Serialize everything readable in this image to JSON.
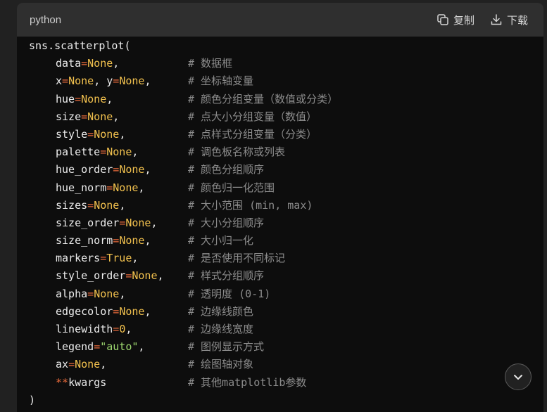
{
  "header": {
    "language": "python",
    "copy_label": "复制",
    "download_label": "下载",
    "copy_icon": "copy-icon",
    "download_icon": "download-icon"
  },
  "code": {
    "opening": "sns.scatterplot(",
    "closing": ")",
    "params": [
      {
        "name": "data",
        "op": "=",
        "value": "None",
        "value_type": "none",
        "suffix": ",",
        "comment": "# 数据框"
      },
      {
        "name": "x",
        "op": "=",
        "value": "None",
        "value_type": "none",
        "suffix": ", ",
        "name2": "y",
        "value2": "None",
        "suffix2": ",",
        "comment": "# 坐标轴变量"
      },
      {
        "name": "hue",
        "op": "=",
        "value": "None",
        "value_type": "none",
        "suffix": ",",
        "comment": "# 颜色分组变量（数值或分类）"
      },
      {
        "name": "size",
        "op": "=",
        "value": "None",
        "value_type": "none",
        "suffix": ",",
        "comment": "# 点大小分组变量（数值）"
      },
      {
        "name": "style",
        "op": "=",
        "value": "None",
        "value_type": "none",
        "suffix": ",",
        "comment": "# 点样式分组变量（分类）"
      },
      {
        "name": "palette",
        "op": "=",
        "value": "None",
        "value_type": "none",
        "suffix": ",",
        "comment": "# 调色板名称或列表"
      },
      {
        "name": "hue_order",
        "op": "=",
        "value": "None",
        "value_type": "none",
        "suffix": ",",
        "comment": "# 颜色分组顺序"
      },
      {
        "name": "hue_norm",
        "op": "=",
        "value": "None",
        "value_type": "none",
        "suffix": ",",
        "comment": "# 颜色归一化范围"
      },
      {
        "name": "sizes",
        "op": "=",
        "value": "None",
        "value_type": "none",
        "suffix": ",",
        "comment": "# 大小范围 (min, max)"
      },
      {
        "name": "size_order",
        "op": "=",
        "value": "None",
        "value_type": "none",
        "suffix": ",",
        "comment": "# 大小分组顺序"
      },
      {
        "name": "size_norm",
        "op": "=",
        "value": "None",
        "value_type": "none",
        "suffix": ",",
        "comment": "# 大小归一化"
      },
      {
        "name": "markers",
        "op": "=",
        "value": "True",
        "value_type": "none",
        "suffix": ",",
        "comment": "# 是否使用不同标记"
      },
      {
        "name": "style_order",
        "op": "=",
        "value": "None",
        "value_type": "none",
        "suffix": ",",
        "comment": "# 样式分组顺序"
      },
      {
        "name": "alpha",
        "op": "=",
        "value": "None",
        "value_type": "none",
        "suffix": ",",
        "comment": "# 透明度 (0-1)"
      },
      {
        "name": "edgecolor",
        "op": "=",
        "value": "None",
        "value_type": "none",
        "suffix": ",",
        "comment": "# 边缘线颜色"
      },
      {
        "name": "linewidth",
        "op": "=",
        "value": "0",
        "value_type": "none",
        "suffix": ",",
        "comment": "# 边缘线宽度"
      },
      {
        "name": "legend",
        "op": "=",
        "value": "\"auto\"",
        "value_type": "str",
        "suffix": ",",
        "comment": "# 图例显示方式"
      },
      {
        "name": "ax",
        "op": "=",
        "value": "None",
        "value_type": "none",
        "suffix": ",",
        "comment": "# 绘图轴对象"
      },
      {
        "name": "kwargs",
        "op": "**",
        "value": "",
        "value_type": "kwargs",
        "suffix": "",
        "comment": "# 其他matplotlib参数"
      }
    ]
  },
  "scroll_button": {
    "icon": "chevron-down-icon"
  },
  "colors": {
    "background": "#212121",
    "code_background": "#0d0d0d",
    "header_background": "#2f2f2f",
    "operator": "#ec6c3c",
    "none_value": "#f2c14e",
    "string_value": "#9dd86f",
    "comment": "#8c8c8c"
  }
}
